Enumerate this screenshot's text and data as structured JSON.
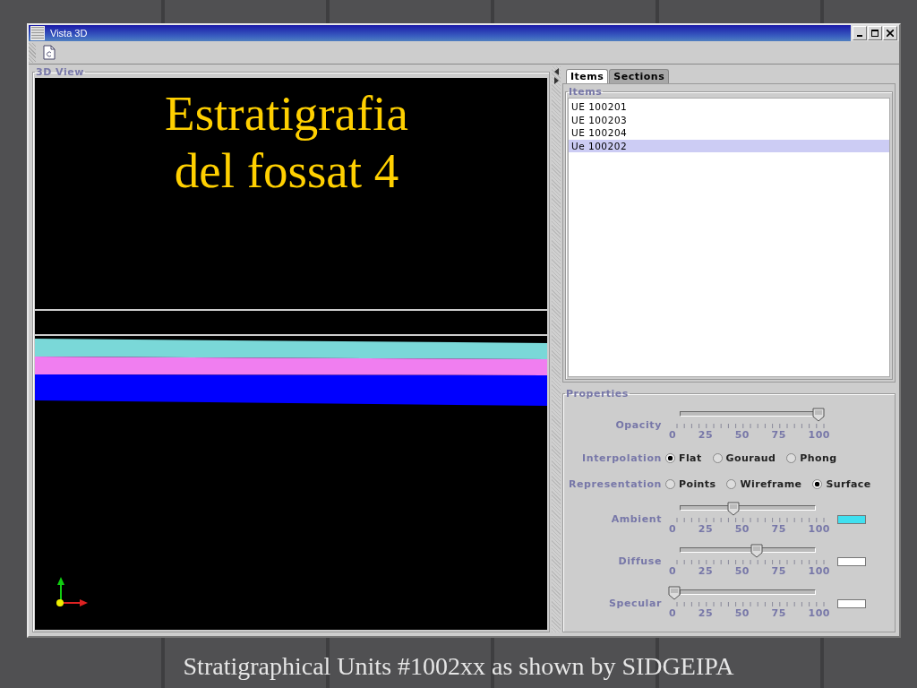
{
  "window": {
    "title": "Vista 3D"
  },
  "view": {
    "title": "3D View",
    "overlay_lines": [
      "Estratigrafia",
      "del fossat 4"
    ]
  },
  "tabs": [
    {
      "label": "Items",
      "selected": true
    },
    {
      "label": "Sections",
      "selected": false
    }
  ],
  "items": {
    "title": "Items",
    "rows": [
      {
        "label": "UE 100201",
        "selected": false
      },
      {
        "label": "UE 100203",
        "selected": false
      },
      {
        "label": "UE 100204",
        "selected": false
      },
      {
        "label": "Ue 100202",
        "selected": true
      }
    ]
  },
  "properties": {
    "title": "Properties",
    "rows": [
      {
        "kind": "slider",
        "label": "Opacity",
        "level": 0.98,
        "ticks": [
          "0",
          "25",
          "50",
          "75",
          "100"
        ]
      },
      {
        "kind": "radio",
        "label": "Interpolation",
        "options": [
          {
            "label": "Flat",
            "selected": true
          },
          {
            "label": "Gouraud",
            "selected": false
          },
          {
            "label": "Phong",
            "selected": false
          }
        ]
      },
      {
        "kind": "radio",
        "label": "Representation",
        "options": [
          {
            "label": "Points",
            "selected": false
          },
          {
            "label": "Wireframe",
            "selected": false
          },
          {
            "label": "Surface",
            "selected": true
          }
        ]
      },
      {
        "kind": "slider",
        "label": "Ambient",
        "level": 0.4,
        "ticks": [
          "0",
          "25",
          "50",
          "75",
          "100"
        ],
        "color": "#40e0f0"
      },
      {
        "kind": "slider",
        "label": "Diffuse",
        "level": 0.56,
        "ticks": [
          "0",
          "25",
          "50",
          "75",
          "100"
        ],
        "color": "#ffffff"
      },
      {
        "kind": "slider",
        "label": "Specular",
        "level": 0.0,
        "ticks": [
          "0",
          "25",
          "50",
          "75",
          "100"
        ],
        "color": "#ffffff"
      }
    ]
  },
  "caption": "Stratigraphical Units #1002xx as shown by SIDGEIPA"
}
